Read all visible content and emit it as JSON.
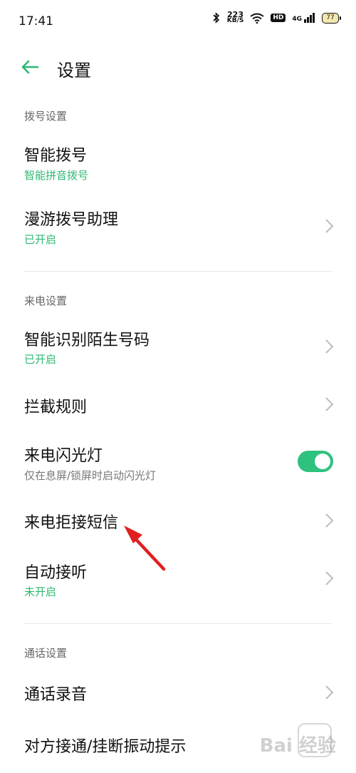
{
  "status_bar": {
    "time": "17:41",
    "speed_value": "223",
    "speed_unit": "KB/S",
    "hd_label": "HD",
    "network": "4G",
    "battery": "77",
    "icons": [
      "bluetooth-icon",
      "wifi-icon",
      "signal-icon",
      "battery-icon"
    ]
  },
  "header": {
    "back_icon": "arrow-left-icon",
    "title": "设置"
  },
  "sections": {
    "dial": {
      "header": "拨号设置",
      "smart_dial": {
        "title": "智能拨号",
        "subtitle": "智能拼音拨号"
      },
      "roaming": {
        "title": "漫游拨号助理",
        "subtitle": "已开启"
      }
    },
    "incoming": {
      "header": "来电设置",
      "identify": {
        "title": "智能识别陌生号码",
        "subtitle": "已开启"
      },
      "block": {
        "title": "拦截规则"
      },
      "flash": {
        "title": "来电闪光灯",
        "subtitle": "仅在息屏/锁屏时启动闪光灯",
        "enabled": true
      },
      "reject_sms": {
        "title": "来电拒接短信"
      },
      "auto_answer": {
        "title": "自动接听",
        "subtitle": "未开启"
      }
    },
    "call": {
      "header": "通话设置",
      "recording": {
        "title": "通话录音"
      },
      "vibration": {
        "title": "对方接通/挂断振动提示"
      }
    }
  },
  "watermark": "Bai 经验",
  "colors": {
    "accent": "#2eb872",
    "toggle_on": "#2ec27e",
    "annotation_arrow": "#e02020"
  }
}
